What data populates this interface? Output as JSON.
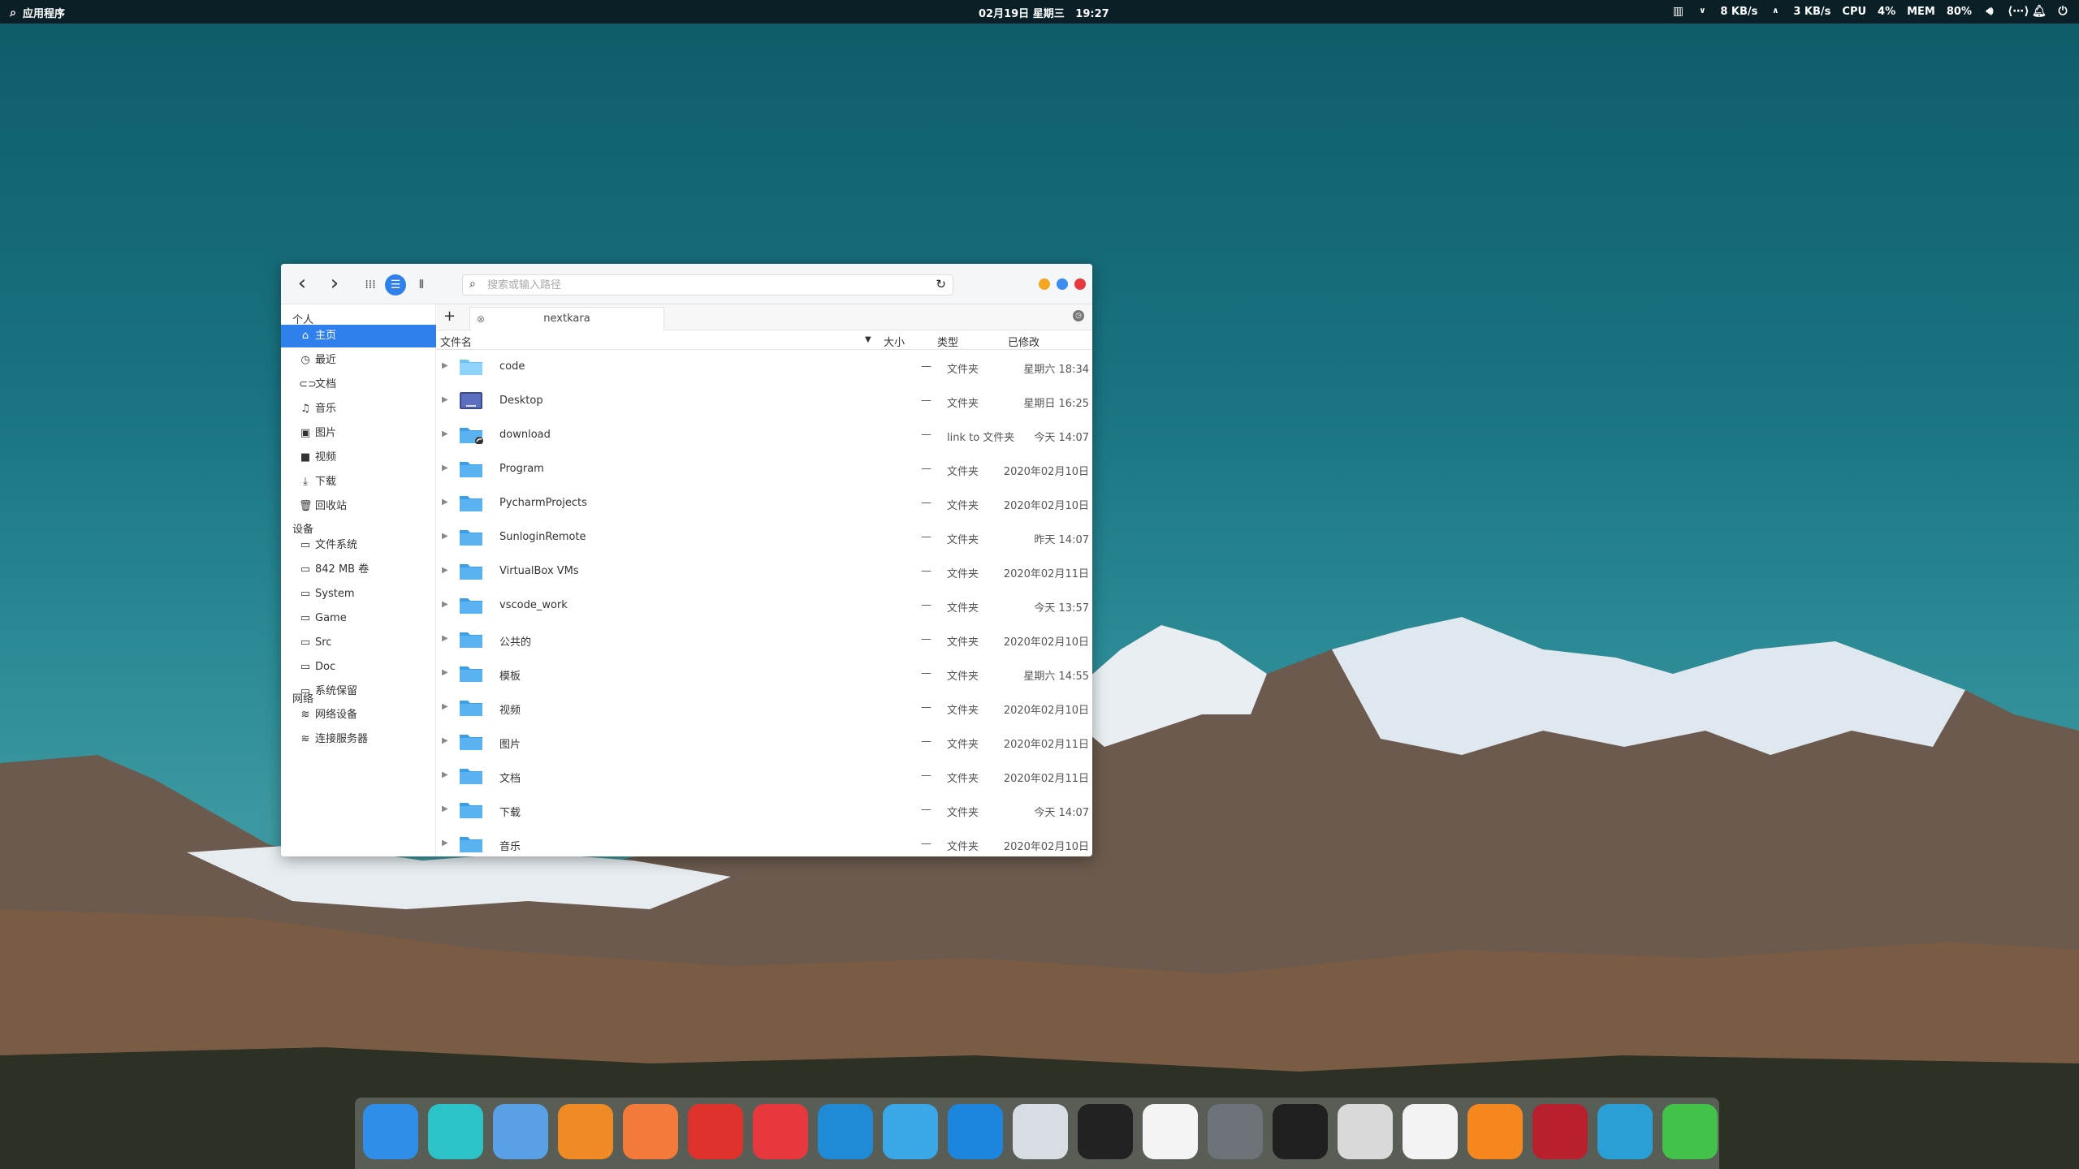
{
  "topbar": {
    "apps_label": "应用程序",
    "datetime": "02月19日 星期三   19:27",
    "net_down": "8 KB/s",
    "net_up": "3 KB/s",
    "cpu_label": "CPU",
    "cpu_value": "4%",
    "mem_label": "MEM",
    "mem_value": "80%"
  },
  "window": {
    "search_placeholder": "搜索或输入路径",
    "sidebar": {
      "personal_header": "个人",
      "personal": [
        {
          "label": "主页",
          "icon": "home-icon",
          "active": true
        },
        {
          "label": "最近",
          "icon": "clock-icon"
        },
        {
          "label": "文档",
          "icon": "document-icon"
        },
        {
          "label": "音乐",
          "icon": "music-icon"
        },
        {
          "label": "图片",
          "icon": "image-icon"
        },
        {
          "label": "视频",
          "icon": "video-icon"
        },
        {
          "label": "下载",
          "icon": "download-icon"
        },
        {
          "label": "回收站",
          "icon": "trash-icon"
        }
      ],
      "devices_header": "设备",
      "devices": [
        {
          "label": "文件系统",
          "icon": "drive-icon"
        },
        {
          "label": "842 MB 卷",
          "icon": "drive-icon"
        },
        {
          "label": "System",
          "icon": "drive-icon"
        },
        {
          "label": "Game",
          "icon": "drive-icon"
        },
        {
          "label": "Src",
          "icon": "drive-icon"
        },
        {
          "label": "Doc",
          "icon": "drive-icon"
        },
        {
          "label": "系统保留",
          "icon": "drive-icon"
        }
      ],
      "network_header": "网络",
      "network": [
        {
          "label": "网络设备",
          "icon": "wifi-icon"
        },
        {
          "label": "连接服务器",
          "icon": "wifi-icon"
        }
      ]
    },
    "tab": {
      "add": "+",
      "label": "nextkara"
    },
    "columns": {
      "name": "文件名",
      "size": "大小",
      "type": "类型",
      "modified": "已修改"
    },
    "files": [
      {
        "name": "code",
        "size": "—",
        "type": "文件夹",
        "modified": "星期六 18:34",
        "folder": "light"
      },
      {
        "name": "Desktop",
        "size": "—",
        "type": "文件夹",
        "modified": "星期日 16:25",
        "folder": "desktop"
      },
      {
        "name": "download",
        "size": "—",
        "type": "link to 文件夹",
        "modified": "今天 14:07",
        "folder": "link"
      },
      {
        "name": "Program",
        "size": "—",
        "type": "文件夹",
        "modified": "2020年02月10日",
        "folder": "blue"
      },
      {
        "name": "PycharmProjects",
        "size": "—",
        "type": "文件夹",
        "modified": "2020年02月10日",
        "folder": "blue"
      },
      {
        "name": "SunloginRemote",
        "size": "—",
        "type": "文件夹",
        "modified": "昨天 14:07",
        "folder": "blue"
      },
      {
        "name": "VirtualBox VMs",
        "size": "—",
        "type": "文件夹",
        "modified": "2020年02月11日",
        "folder": "blue"
      },
      {
        "name": "vscode_work",
        "size": "—",
        "type": "文件夹",
        "modified": "今天 13:57",
        "folder": "blue"
      },
      {
        "name": "公共的",
        "size": "—",
        "type": "文件夹",
        "modified": "2020年02月10日",
        "folder": "blue"
      },
      {
        "name": "模板",
        "size": "—",
        "type": "文件夹",
        "modified": "星期六 14:55",
        "folder": "blue"
      },
      {
        "name": "视频",
        "size": "—",
        "type": "文件夹",
        "modified": "2020年02月10日",
        "folder": "blue"
      },
      {
        "name": "图片",
        "size": "—",
        "type": "文件夹",
        "modified": "2020年02月11日",
        "folder": "blue"
      },
      {
        "name": "文档",
        "size": "—",
        "type": "文件夹",
        "modified": "2020年02月11日",
        "folder": "blue"
      },
      {
        "name": "下载",
        "size": "—",
        "type": "文件夹",
        "modified": "今天 14:07",
        "folder": "blue"
      },
      {
        "name": "音乐",
        "size": "—",
        "type": "文件夹",
        "modified": "2020年02月10日",
        "folder": "blue"
      }
    ]
  },
  "dock": {
    "apps": [
      {
        "name": "finder-icon",
        "color": "#2f8fe8"
      },
      {
        "name": "mail-icon",
        "color": "#2cc3c8"
      },
      {
        "name": "mail-client-icon",
        "color": "#5aa0e6"
      },
      {
        "name": "firefox-icon",
        "color": "#f08a24"
      },
      {
        "name": "screenshot-icon",
        "color": "#f37a3a"
      },
      {
        "name": "netease-music-icon",
        "color": "#e0322d"
      },
      {
        "name": "xmind-icon",
        "color": "#e8383d"
      },
      {
        "name": "vscode-icon",
        "color": "#1f8ad6"
      },
      {
        "name": "virtualbox-icon",
        "color": "#3aa7e6"
      },
      {
        "name": "teamviewer-icon",
        "color": "#1c86df"
      },
      {
        "name": "screen-recorder-icon",
        "color": "#d8dde3"
      },
      {
        "name": "terminal-icon",
        "color": "#222222"
      },
      {
        "name": "typora-icon",
        "color": "#f4f4f4"
      },
      {
        "name": "settings-icon",
        "color": "#6d7378"
      },
      {
        "name": "obs-icon",
        "color": "#202020"
      },
      {
        "name": "java-icon",
        "color": "#d9d9d9"
      },
      {
        "name": "debian-icon",
        "color": "#f3f3f3"
      },
      {
        "name": "media-player-icon",
        "color": "#f6861e"
      },
      {
        "name": "wine-icon",
        "color": "#b8202d"
      },
      {
        "name": "web-tool-icon",
        "color": "#2a9fd6"
      },
      {
        "name": "wechat-icon",
        "color": "#43c24a"
      }
    ]
  }
}
